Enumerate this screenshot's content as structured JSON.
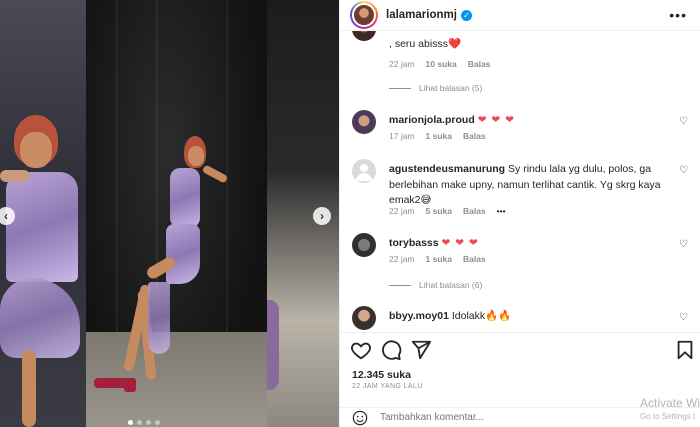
{
  "post": {
    "username": "lalamarionmj",
    "likes": "12.345 suka",
    "time_ago": "22 JAM YANG LALU"
  },
  "comments": [
    {
      "username": "",
      "text": ", seru abisss",
      "emoji": "❤️",
      "time": "22 jam",
      "likes": "10 suka",
      "reply": "Balas",
      "view_replies": ""
    },
    {
      "username": "",
      "text": "",
      "emoji": "",
      "time": "",
      "likes": "",
      "reply": "",
      "view_replies": "Lihat balasan (5)"
    },
    {
      "username": "marionjola.proud",
      "text": "",
      "emoji": "❤ ❤ ❤",
      "time": "17 jam",
      "likes": "1 suka",
      "reply": "Balas"
    },
    {
      "username": "agustendeusmanurung",
      "text": "Sy rindu lala yg dulu, polos, ga berlebihan make upny, namun terlihat cantik. Yg skrg kaya emak2",
      "emoji": "😅",
      "time": "22 jam",
      "likes": "5 suka",
      "reply": "Balas",
      "more": "•••"
    },
    {
      "username": "torybasss",
      "text": "",
      "emoji": "❤ ❤ ❤",
      "time": "22 jam",
      "likes": "1 suka",
      "reply": "Balas",
      "view_replies": "Lihat balasan (6)"
    },
    {
      "username": "bbyy.moy01",
      "text": "Idolakk",
      "emoji": "🔥🔥"
    }
  ],
  "add_comment": {
    "placeholder": "Tambahkan komentar..."
  },
  "watermark": {
    "title": "Activate Wir",
    "sub": "Go to Settings t"
  },
  "icons": [
    "heart-icon",
    "comment-icon",
    "share-icon",
    "bookmark-icon",
    "smiley-icon",
    "verified-icon",
    "more-icon",
    "chevron-left-icon",
    "chevron-right-icon"
  ],
  "colors": {
    "accent": "#0095f6",
    "heart": "#ed4956",
    "muted": "#8e8e8e",
    "text": "#262626"
  }
}
